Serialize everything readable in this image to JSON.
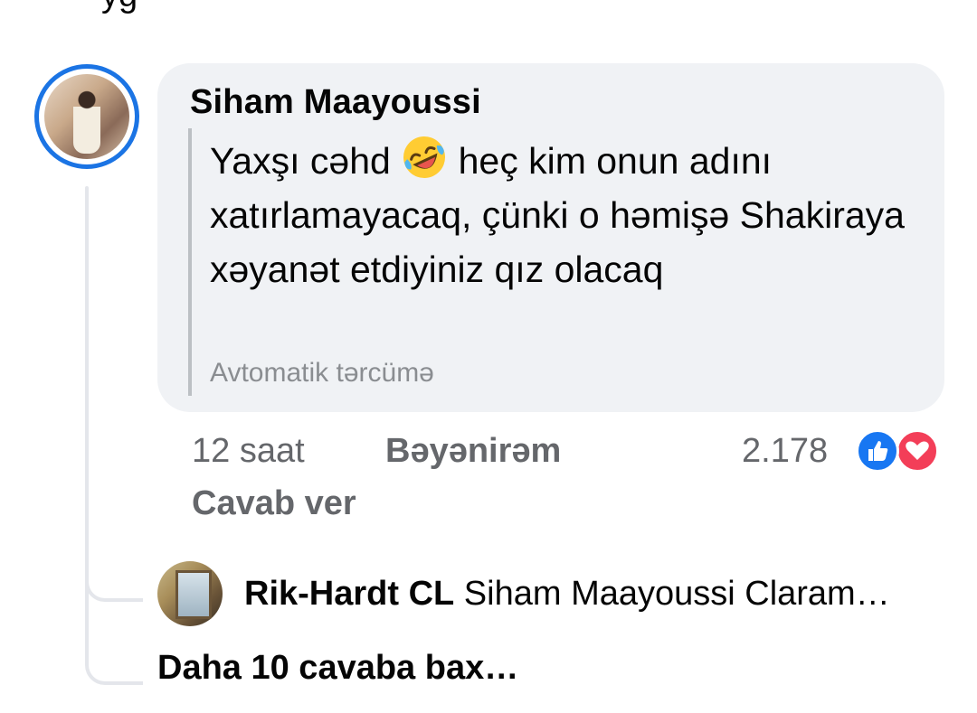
{
  "top_partial_text": "yg",
  "comment": {
    "author": "Siham Maayoussi",
    "text_before_emoji": "Yaxşı cəhd ",
    "emoji_name": "rolling-on-floor-laughing",
    "text_after_emoji": " heç kim onun adını xatırlamayacaq, çünki o həmişə Shakiraya xəyanət etdiyiniz qız olacaq",
    "translation_label": "Avtomatik tərcümə",
    "time": "12 saat",
    "like_label": "Bəyənirəm",
    "reply_label": "Cavab ver",
    "reaction_count": "2.178",
    "reactions": [
      "like-icon",
      "love-icon"
    ],
    "colors": {
      "like": "#1877f2",
      "love": "#f33e58",
      "avatar_ring": "#1b74e4",
      "bubble": "#f0f2f5"
    }
  },
  "reply": {
    "author": "Rik-Hardt CL",
    "preview": "Siham Maayoussi Claram…"
  },
  "more_replies_label": "Daha 10 cavaba bax…"
}
